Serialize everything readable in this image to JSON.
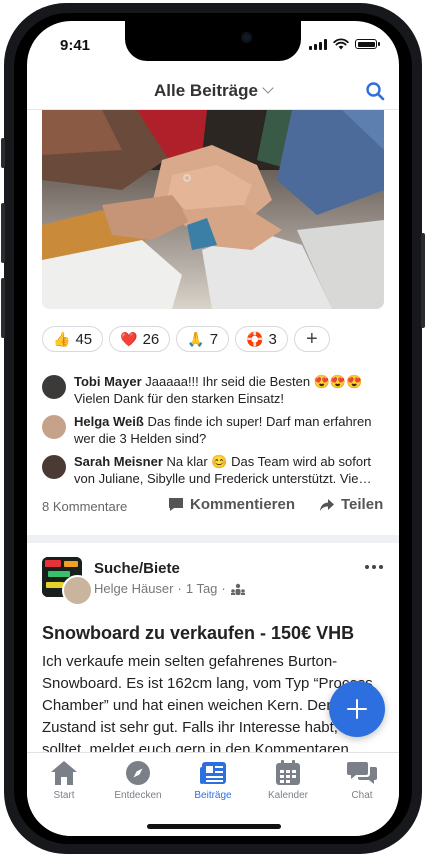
{
  "status": {
    "time": "9:41"
  },
  "header": {
    "title": "Alle Beiträge"
  },
  "reactions": [
    {
      "emoji": "👍",
      "count": "45"
    },
    {
      "emoji": "❤️",
      "count": "26"
    },
    {
      "emoji": "🙏",
      "count": "7"
    },
    {
      "emoji": "🛟",
      "count": "3"
    }
  ],
  "comments": [
    {
      "name": "Tobi Mayer",
      "text": "Jaaaaa!!! Ihr seid die Besten 😍😍😍 Vielen Dank für den starken Einsatz!"
    },
    {
      "name": "Helga Weiß",
      "text": "Das finde ich super! Darf man erfahren wer die 3 Helden sind?"
    },
    {
      "name": "Sarah Meisner",
      "text": "Na klar 😊 Das Team wird ab sofort von Juliane, Sibylle und Frederick unterstützt. Vie…"
    }
  ],
  "post1_actions": {
    "comment_count": "8 Kommentare",
    "comment_label": "Kommentieren",
    "share_label": "Teilen"
  },
  "post2": {
    "group": "Suche/Biete",
    "author": "Helge Häuser",
    "time": "1 Tag",
    "title": "Snowboard zu verkaufen - 150€ VHB",
    "body": "Ich verkaufe mein selten gefahrenes Burton-Snowboard. Es ist 162cm lang, vom Typ “Process Chamber” und hat einen weichen Kern. Der Zustand ist sehr gut. Falls ihr Interesse habt, solltet, meldet euch gern in den Kommentaren"
  },
  "tabs": [
    {
      "label": "Start",
      "icon": "home-icon"
    },
    {
      "label": "Entdecken",
      "icon": "compass-icon"
    },
    {
      "label": "Beiträge",
      "icon": "newspaper-icon",
      "active": true
    },
    {
      "label": "Kalender",
      "icon": "calendar-icon"
    },
    {
      "label": "Chat",
      "icon": "chat-icon"
    }
  ],
  "colors": {
    "accent": "#2e6fe0",
    "text": "#222222",
    "muted": "#777777"
  }
}
